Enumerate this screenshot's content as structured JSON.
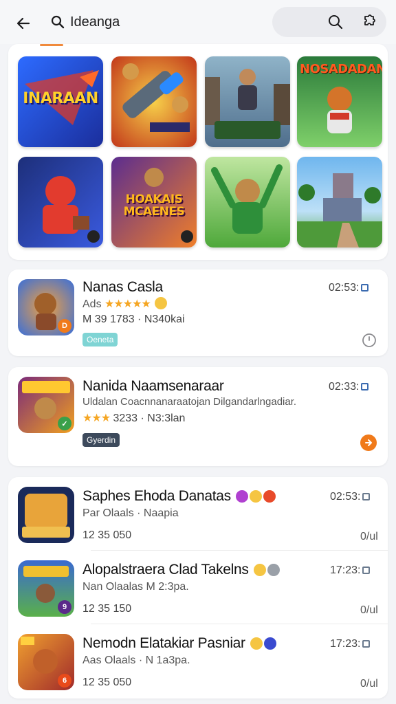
{
  "header": {
    "search_query": "Ideanga",
    "back_icon": "arrow-left-icon",
    "search_icon": "search-icon",
    "actions": [
      "search-icon",
      "puzzle-icon"
    ]
  },
  "grid": {
    "tiles": [
      {
        "title": "INARAAN",
        "colors": [
          "#1b2e9c",
          "#2d6bff"
        ],
        "title_color": "#ffd12a"
      },
      {
        "title": "",
        "caption": "",
        "colors": [
          "#e8591e",
          "#f7b733"
        ]
      },
      {
        "title": "",
        "caption": "",
        "colors": [
          "#4f7b9c",
          "#8fb3c8"
        ]
      },
      {
        "title": "NOSADADAN",
        "colors": [
          "#2a9f4a",
          "#7fd06a"
        ],
        "title_color": "#ff5a1f"
      },
      {
        "title": "",
        "colors": [
          "#1d2f7a",
          "#e23b2e"
        ]
      },
      {
        "title": "HOAKAIS MCAENES",
        "colors": [
          "#5b2d8f",
          "#f07f2a"
        ],
        "title_color": "#ffb81c"
      },
      {
        "title": "",
        "colors": [
          "#6cc447",
          "#2e8f3a"
        ]
      },
      {
        "title": "",
        "colors": [
          "#6fb6ee",
          "#57a845"
        ]
      }
    ],
    "tile_captions": [
      "",
      "",
      "",
      "",
      "",
      "",
      "",
      ""
    ]
  },
  "featured": [
    {
      "name": "Nanas Casla",
      "sub": "Ads",
      "rating_stars": "★★★★★",
      "meta": "M 39 1783 · N340kai",
      "time": "02:53:",
      "tag": "Oeneta",
      "tag_color": "#7fd4d4",
      "action_icon": "clock-icon",
      "icon_colors": [
        "#f08a2a",
        "#3a6fd9"
      ]
    },
    {
      "name": "Nanida Naamsenaraar",
      "sub": "Uldalan Coacnnanaraatojan Dilgandarlngadiar.",
      "rating_stars": "★★★",
      "meta": "3233 · N3:3lan",
      "time": "02:33:",
      "tag": "Gyerdin",
      "tag_color": "#3d4a5c",
      "action_icon": "arrow-right-icon",
      "icon_colors": [
        "#7a2a7a",
        "#f0a020"
      ]
    }
  ],
  "list": [
    {
      "name": "Saphes Ehoda Danatas",
      "sub": "Par Olaals · Naapia",
      "meta": "12 35 050",
      "time": "02:53:",
      "trail": "0/ul",
      "icon_colors": [
        "#e8a43a",
        "#1a2a5a"
      ]
    },
    {
      "name": "Alopalstraera Clad Takelns",
      "sub": "Nan Olaalas M 2:3pa.",
      "meta": "12 35 150",
      "time": "17:23:",
      "trail": "0/ul",
      "icon_colors": [
        "#5ab04a",
        "#3a6ad0"
      ]
    },
    {
      "name": "Nemodn Elatakiar Pasniar",
      "sub": "Aas Olaals · N 1a3pa.",
      "meta": "12 35 050",
      "time": "17:23:",
      "trail": "0/ul",
      "icon_colors": [
        "#f0a030",
        "#a02a2a"
      ]
    }
  ]
}
